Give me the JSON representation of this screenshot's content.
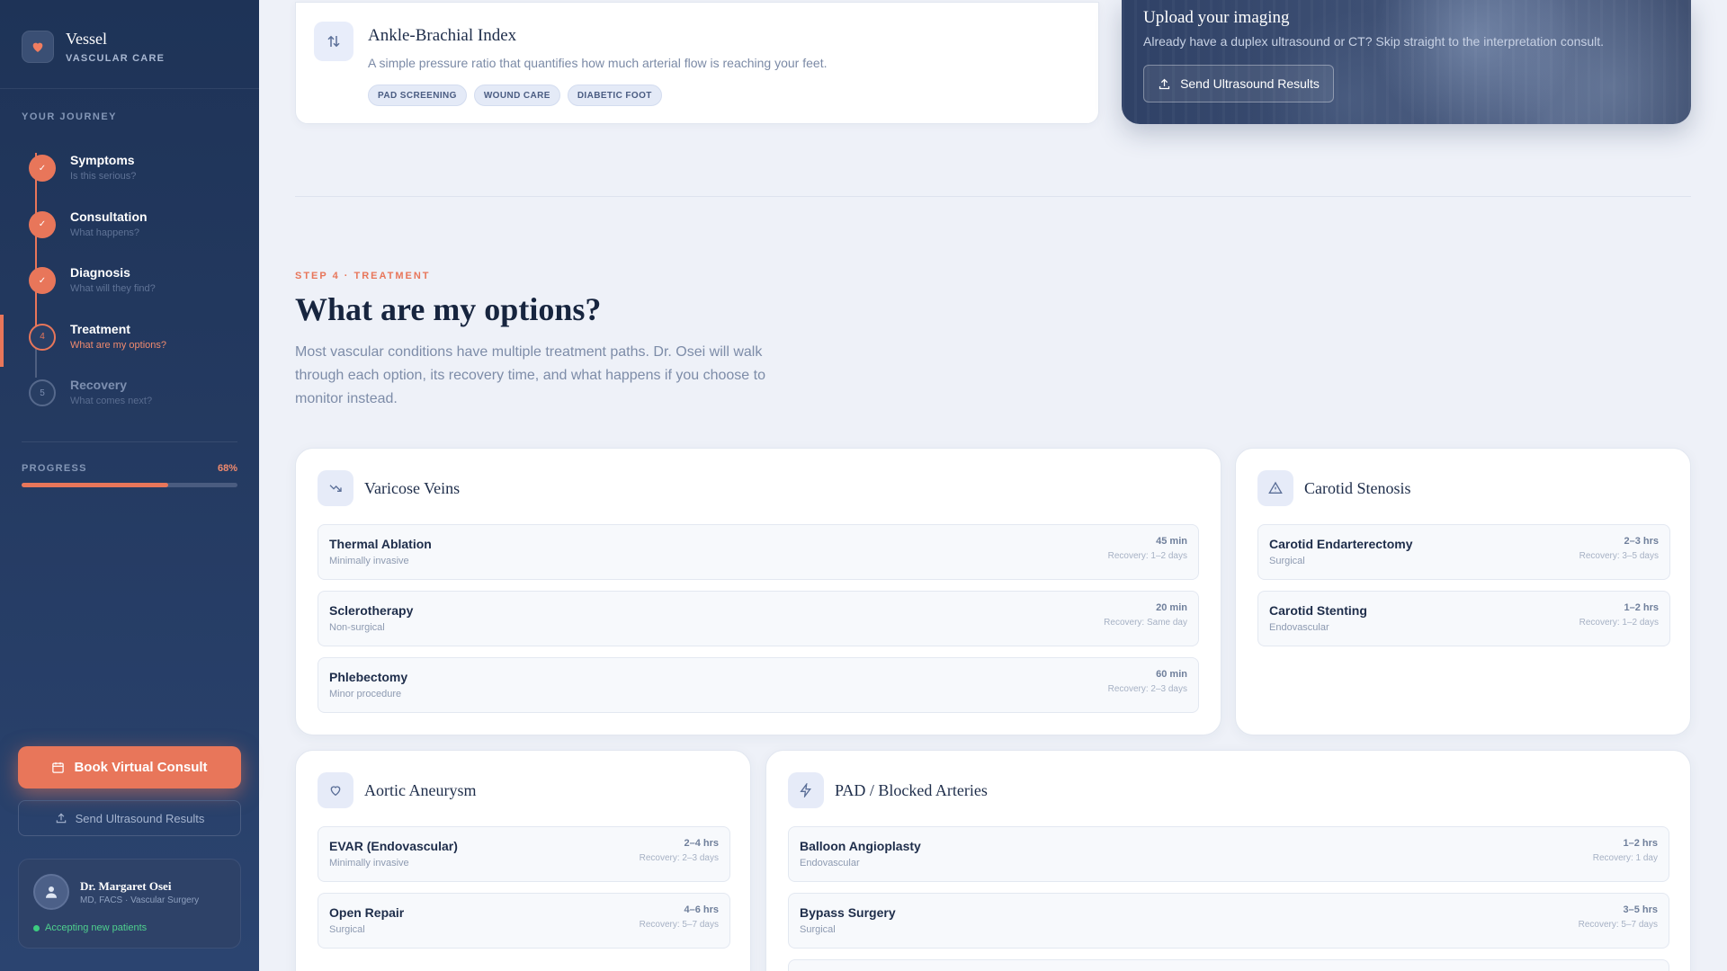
{
  "brand": {
    "name": "Vessel",
    "subtitle": "VASCULAR CARE"
  },
  "journey": {
    "label": "YOUR JOURNEY",
    "steps": [
      {
        "title": "Symptoms",
        "subtitle": "Is this serious?",
        "state": "done",
        "marker": "✓"
      },
      {
        "title": "Consultation",
        "subtitle": "What happens?",
        "state": "done",
        "marker": "✓"
      },
      {
        "title": "Diagnosis",
        "subtitle": "What will they find?",
        "state": "done",
        "marker": "✓"
      },
      {
        "title": "Treatment",
        "subtitle": "What are my options?",
        "state": "active",
        "marker": "4"
      },
      {
        "title": "Recovery",
        "subtitle": "What comes next?",
        "state": "todo",
        "marker": "5"
      }
    ]
  },
  "progress": {
    "label": "PROGRESS",
    "value_text": "68%",
    "fraction": 0.68
  },
  "sidebar_actions": {
    "book_label": "Book Virtual Consult",
    "upload_label": "Send Ultrasound Results"
  },
  "doctor": {
    "name": "Dr. Margaret Osei",
    "credentials": "MD, FACS · Vascular Surgery",
    "status": "Accepting new patients"
  },
  "abi_card": {
    "title": "Ankle-Brachial Index",
    "description": "A simple pressure ratio that quantifies how much arterial flow is reaching your feet.",
    "tags": [
      "PAD SCREENING",
      "WOUND CARE",
      "DIABETIC FOOT"
    ]
  },
  "upload_card": {
    "title": "Upload your imaging",
    "description": "Already have a duplex ultrasound or CT? Skip straight to the interpretation consult.",
    "button_label": "Send Ultrasound Results"
  },
  "section": {
    "eyebrow": "STEP 4 · TREATMENT",
    "heading": "What are my options?",
    "intro": "Most vascular conditions have multiple treatment paths. Dr. Osei will walk through each option, its recovery time, and what happens if you choose to monitor instead."
  },
  "conditions": {
    "varicose": {
      "title": "Varicose Veins",
      "options": [
        {
          "name": "Thermal Ablation",
          "type": "Minimally invasive",
          "duration": "45 min",
          "recovery": "Recovery: 1–2 days"
        },
        {
          "name": "Sclerotherapy",
          "type": "Non-surgical",
          "duration": "20 min",
          "recovery": "Recovery: Same day"
        },
        {
          "name": "Phlebectomy",
          "type": "Minor procedure",
          "duration": "60 min",
          "recovery": "Recovery: 2–3 days"
        }
      ]
    },
    "carotid": {
      "title": "Carotid Stenosis",
      "options": [
        {
          "name": "Carotid Endarterectomy",
          "type": "Surgical",
          "duration": "2–3 hrs",
          "recovery": "Recovery: 3–5 days"
        },
        {
          "name": "Carotid Stenting",
          "type": "Endovascular",
          "duration": "1–2 hrs",
          "recovery": "Recovery: 1–2 days"
        }
      ]
    },
    "aortic": {
      "title": "Aortic Aneurysm",
      "options": [
        {
          "name": "EVAR (Endovascular)",
          "type": "Minimally invasive",
          "duration": "2–4 hrs",
          "recovery": "Recovery: 2–3 days"
        },
        {
          "name": "Open Repair",
          "type": "Surgical",
          "duration": "4–6 hrs",
          "recovery": "Recovery: 5–7 days"
        }
      ]
    },
    "pad": {
      "title": "PAD / Blocked Arteries",
      "options": [
        {
          "name": "Balloon Angioplasty",
          "type": "Endovascular",
          "duration": "1–2 hrs",
          "recovery": "Recovery: 1 day"
        },
        {
          "name": "Bypass Surgery",
          "type": "Surgical",
          "duration": "3–5 hrs",
          "recovery": "Recovery: 5–7 days"
        }
      ]
    }
  },
  "icons": {
    "brand": "heart-icon",
    "abi": "arrows-updown-icon",
    "upload": "upload-icon",
    "book": "calendar-icon",
    "doctor": "user-icon",
    "varicose": "trend-down-icon",
    "carotid": "alert-triangle-icon",
    "aortic": "heart-outline-icon",
    "pad": "lightning-icon"
  },
  "colors": {
    "accent": "#e8765a",
    "sidebar": "#1e3357",
    "status": "#3ccc80"
  }
}
